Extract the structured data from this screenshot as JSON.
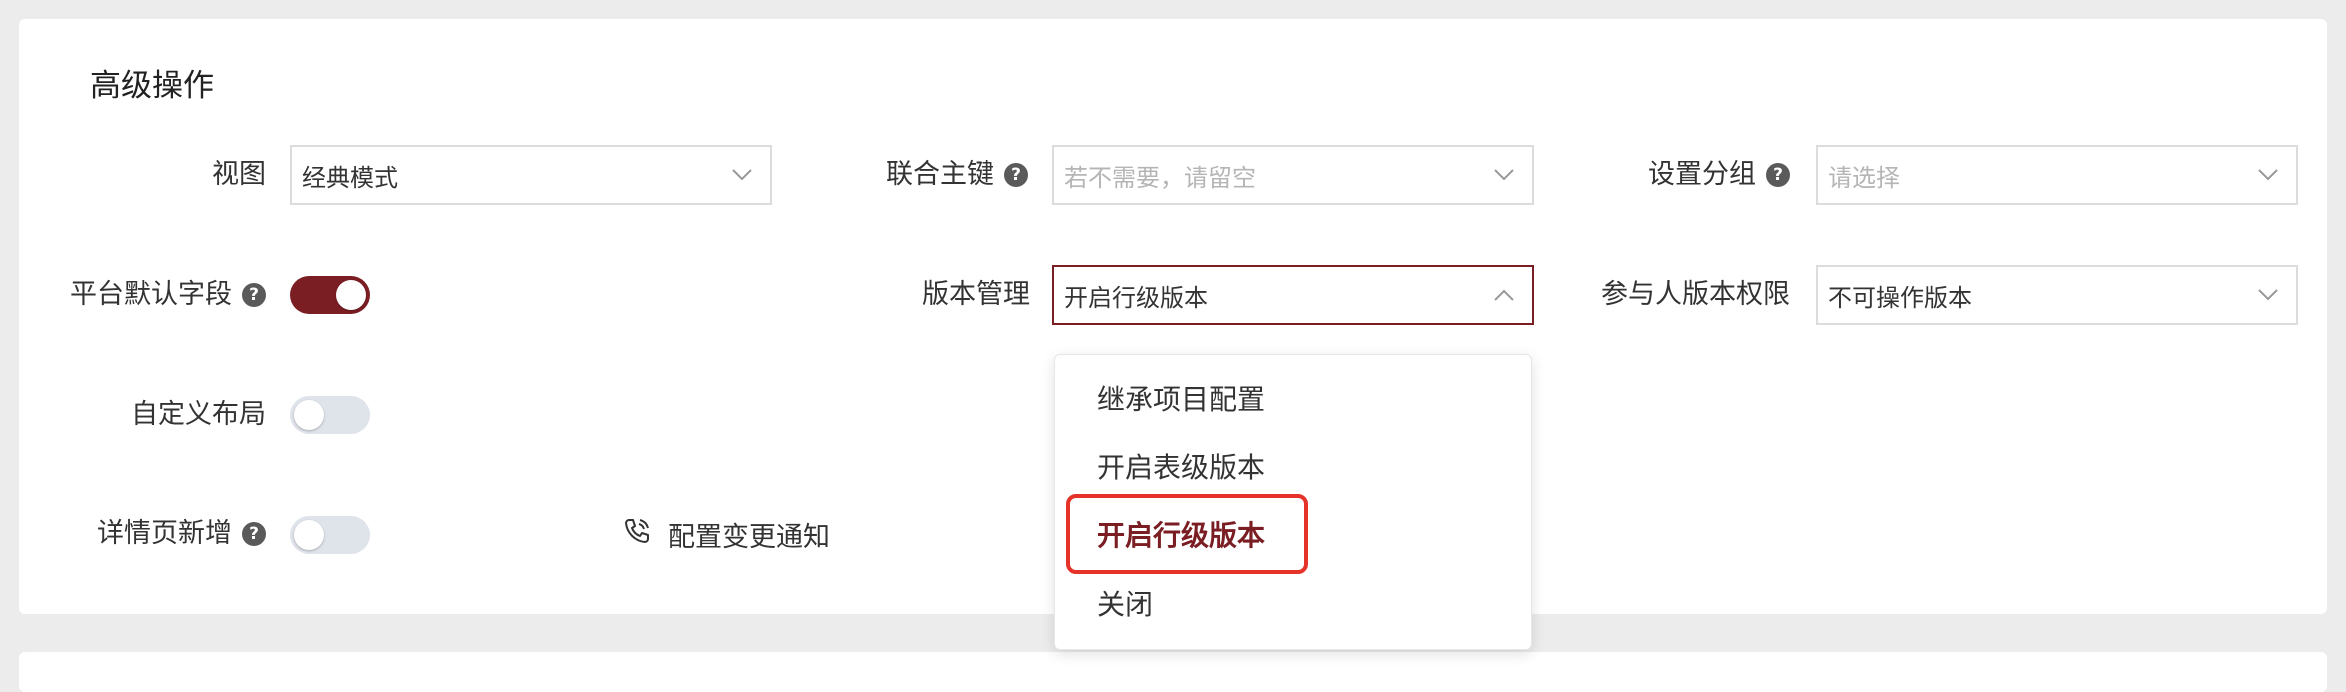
{
  "section": {
    "title": "高级操作"
  },
  "fields": {
    "view": {
      "label": "视图",
      "value": "经典模式"
    },
    "joint_key": {
      "label": "联合主键",
      "placeholder": "若不需要，请留空"
    },
    "group": {
      "label": "设置分组",
      "placeholder": "请选择"
    },
    "platform_default_fields": {
      "label": "平台默认字段",
      "on": true
    },
    "version_management": {
      "label": "版本管理",
      "value": "开启行级版本"
    },
    "participant_version_permission": {
      "label": "参与人版本权限",
      "value": "不可操作版本"
    },
    "custom_layout": {
      "label": "自定义布局",
      "on": false
    },
    "detail_page_add": {
      "label": "详情页新增",
      "on": false
    }
  },
  "notify": {
    "label": "配置变更通知",
    "icon": "phone-icon"
  },
  "version_dropdown": {
    "options": [
      "继承项目配置",
      "开启表级版本",
      "开启行级版本",
      "关闭"
    ],
    "selected": "开启行级版本"
  },
  "colors": {
    "accent": "#7b1e24",
    "highlight": "#e5332a",
    "toggle_off": "#dfe3ea",
    "background": "#ececec"
  }
}
